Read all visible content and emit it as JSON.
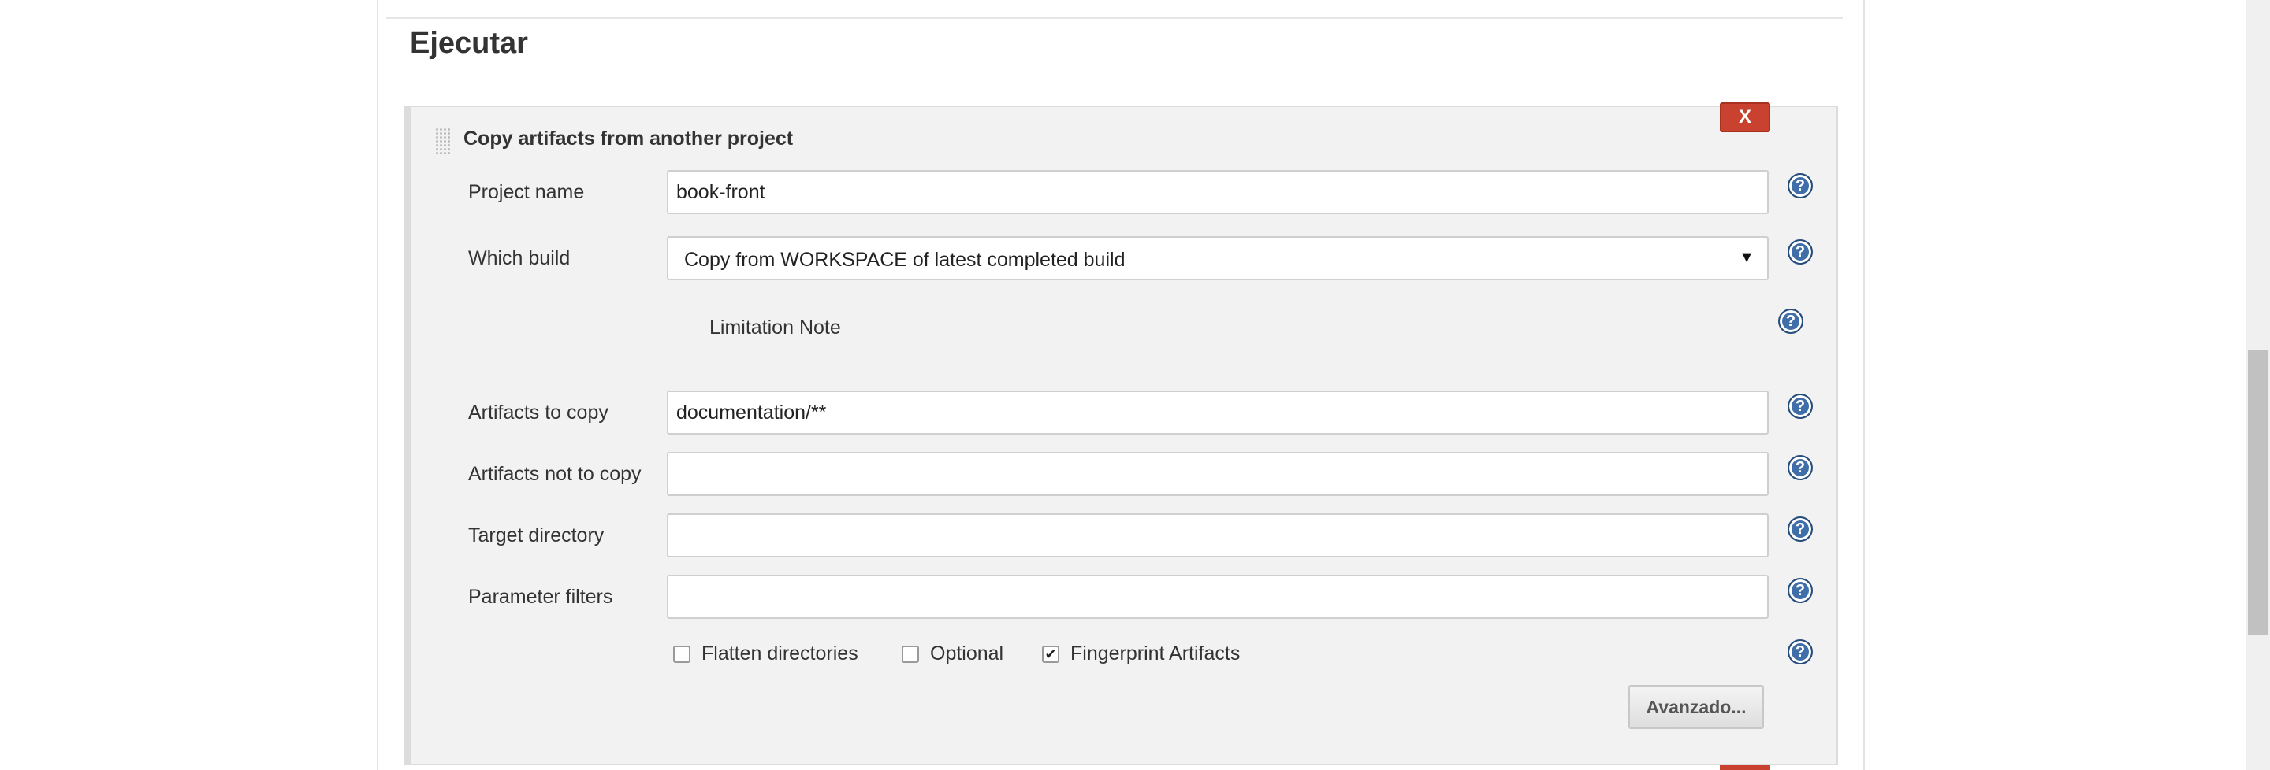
{
  "section": {
    "title": "Ejecutar"
  },
  "builder": {
    "title": "Copy artifacts from another project",
    "delete_label": "X",
    "fields": {
      "project_name": {
        "label": "Project name",
        "value": "book-front"
      },
      "which_build": {
        "label": "Which build",
        "value": "Copy from WORKSPACE of latest completed build"
      },
      "limitation_note": "Limitation Note",
      "artifacts_to_copy": {
        "label": "Artifacts to copy",
        "value": "documentation/**"
      },
      "artifacts_not_to_copy": {
        "label": "Artifacts not to copy",
        "value": ""
      },
      "target_directory": {
        "label": "Target directory",
        "value": ""
      },
      "parameter_filters": {
        "label": "Parameter filters",
        "value": ""
      }
    },
    "options": [
      {
        "label": "Flatten directories",
        "checked": false
      },
      {
        "label": "Optional",
        "checked": false
      },
      {
        "label": "Fingerprint Artifacts",
        "checked": true
      }
    ],
    "advanced_label": "Avanzado...",
    "help_glyph": "?",
    "select_arrow": "▼",
    "check_mark": "✔"
  },
  "colors": {
    "delete_button": "#c9412f",
    "help_icon": "#3f6ea8",
    "builder_bg": "#f2f2f2"
  },
  "icons": [
    "drag-handle-icon",
    "help-icon",
    "dropdown-arrow-icon",
    "checkmark-icon"
  ]
}
